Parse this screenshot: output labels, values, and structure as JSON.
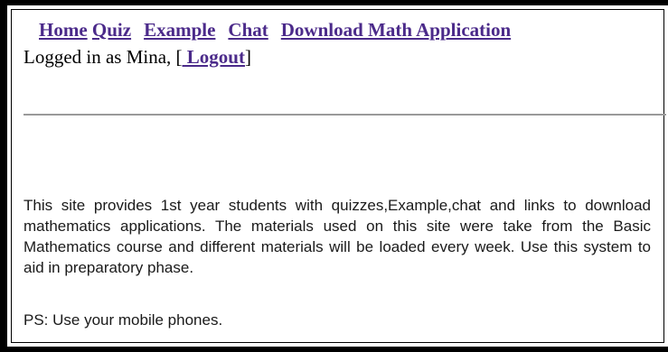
{
  "nav": {
    "items": [
      {
        "label": "Home"
      },
      {
        "label": "Quiz"
      },
      {
        "label": "Example"
      },
      {
        "label": "Chat"
      },
      {
        "label": "Download Math Application"
      }
    ]
  },
  "session": {
    "prefix": "Logged in as Mina, [",
    "logout_label": " Logout",
    "suffix": "]"
  },
  "main": {
    "description": "This site provides 1st year students with quizzes,Example,chat and links to download mathematics applications. The materials used on this site were take from the  Basic Mathematics course and different materials will be loaded every week. Use this system to aid in preparatory phase.",
    "note": "PS: Use your mobile phones."
  },
  "colors": {
    "link": "#4b2a8a",
    "frame": "#000000",
    "divider": "#9a9a9a"
  }
}
